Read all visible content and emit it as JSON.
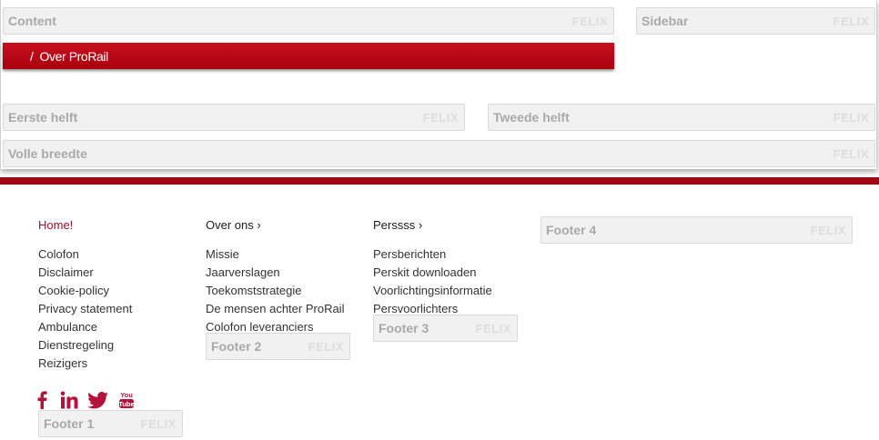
{
  "top": {
    "content_box": {
      "label": "Content",
      "brand": "FELIX"
    },
    "sidebar_box": {
      "label": "Sidebar",
      "brand": "FELIX"
    },
    "breadcrumb": {
      "separator": "/",
      "current": "Over ProRail"
    },
    "eerste_box": {
      "label": "Eerste helft",
      "brand": "FELIX"
    },
    "tweede_box": {
      "label": "Tweede helft",
      "brand": "FELIX"
    },
    "volle_box": {
      "label": "Volle breedte",
      "brand": "FELIX"
    }
  },
  "footer": {
    "col1": {
      "heading": "Home!",
      "links": [
        "Colofon",
        "Disclaimer",
        "Cookie-policy",
        "Privacy statement",
        "Ambulance",
        "Dienstregeling",
        "Reizigers"
      ],
      "box": {
        "label": "Footer 1",
        "brand": "FELIX"
      }
    },
    "col2": {
      "heading": "Over ons ›",
      "links": [
        "Missie",
        "Jaarverslagen",
        "Toekomststrategie",
        "De mensen achter ProRail",
        "Colofon leveranciers"
      ],
      "box": {
        "label": "Footer 2",
        "brand": "FELIX"
      }
    },
    "col3": {
      "heading": "Perssss ›",
      "links": [
        "Persberichten",
        "Perskit downloaden",
        "Voorlichtingsinformatie",
        "Persvoorlichters"
      ],
      "box": {
        "label": "Footer 3",
        "brand": "FELIX"
      }
    },
    "col4": {
      "box": {
        "label": "Footer 4",
        "brand": "FELIX"
      }
    },
    "social": {
      "icons": [
        "facebook-icon",
        "linkedin-icon",
        "twitter-icon",
        "youtube-icon"
      ],
      "youtube_text": [
        "You",
        "Tube"
      ],
      "color": "#b3123a"
    }
  },
  "colors": {
    "brand_red": "#b5000f",
    "divider": "#a30515"
  }
}
